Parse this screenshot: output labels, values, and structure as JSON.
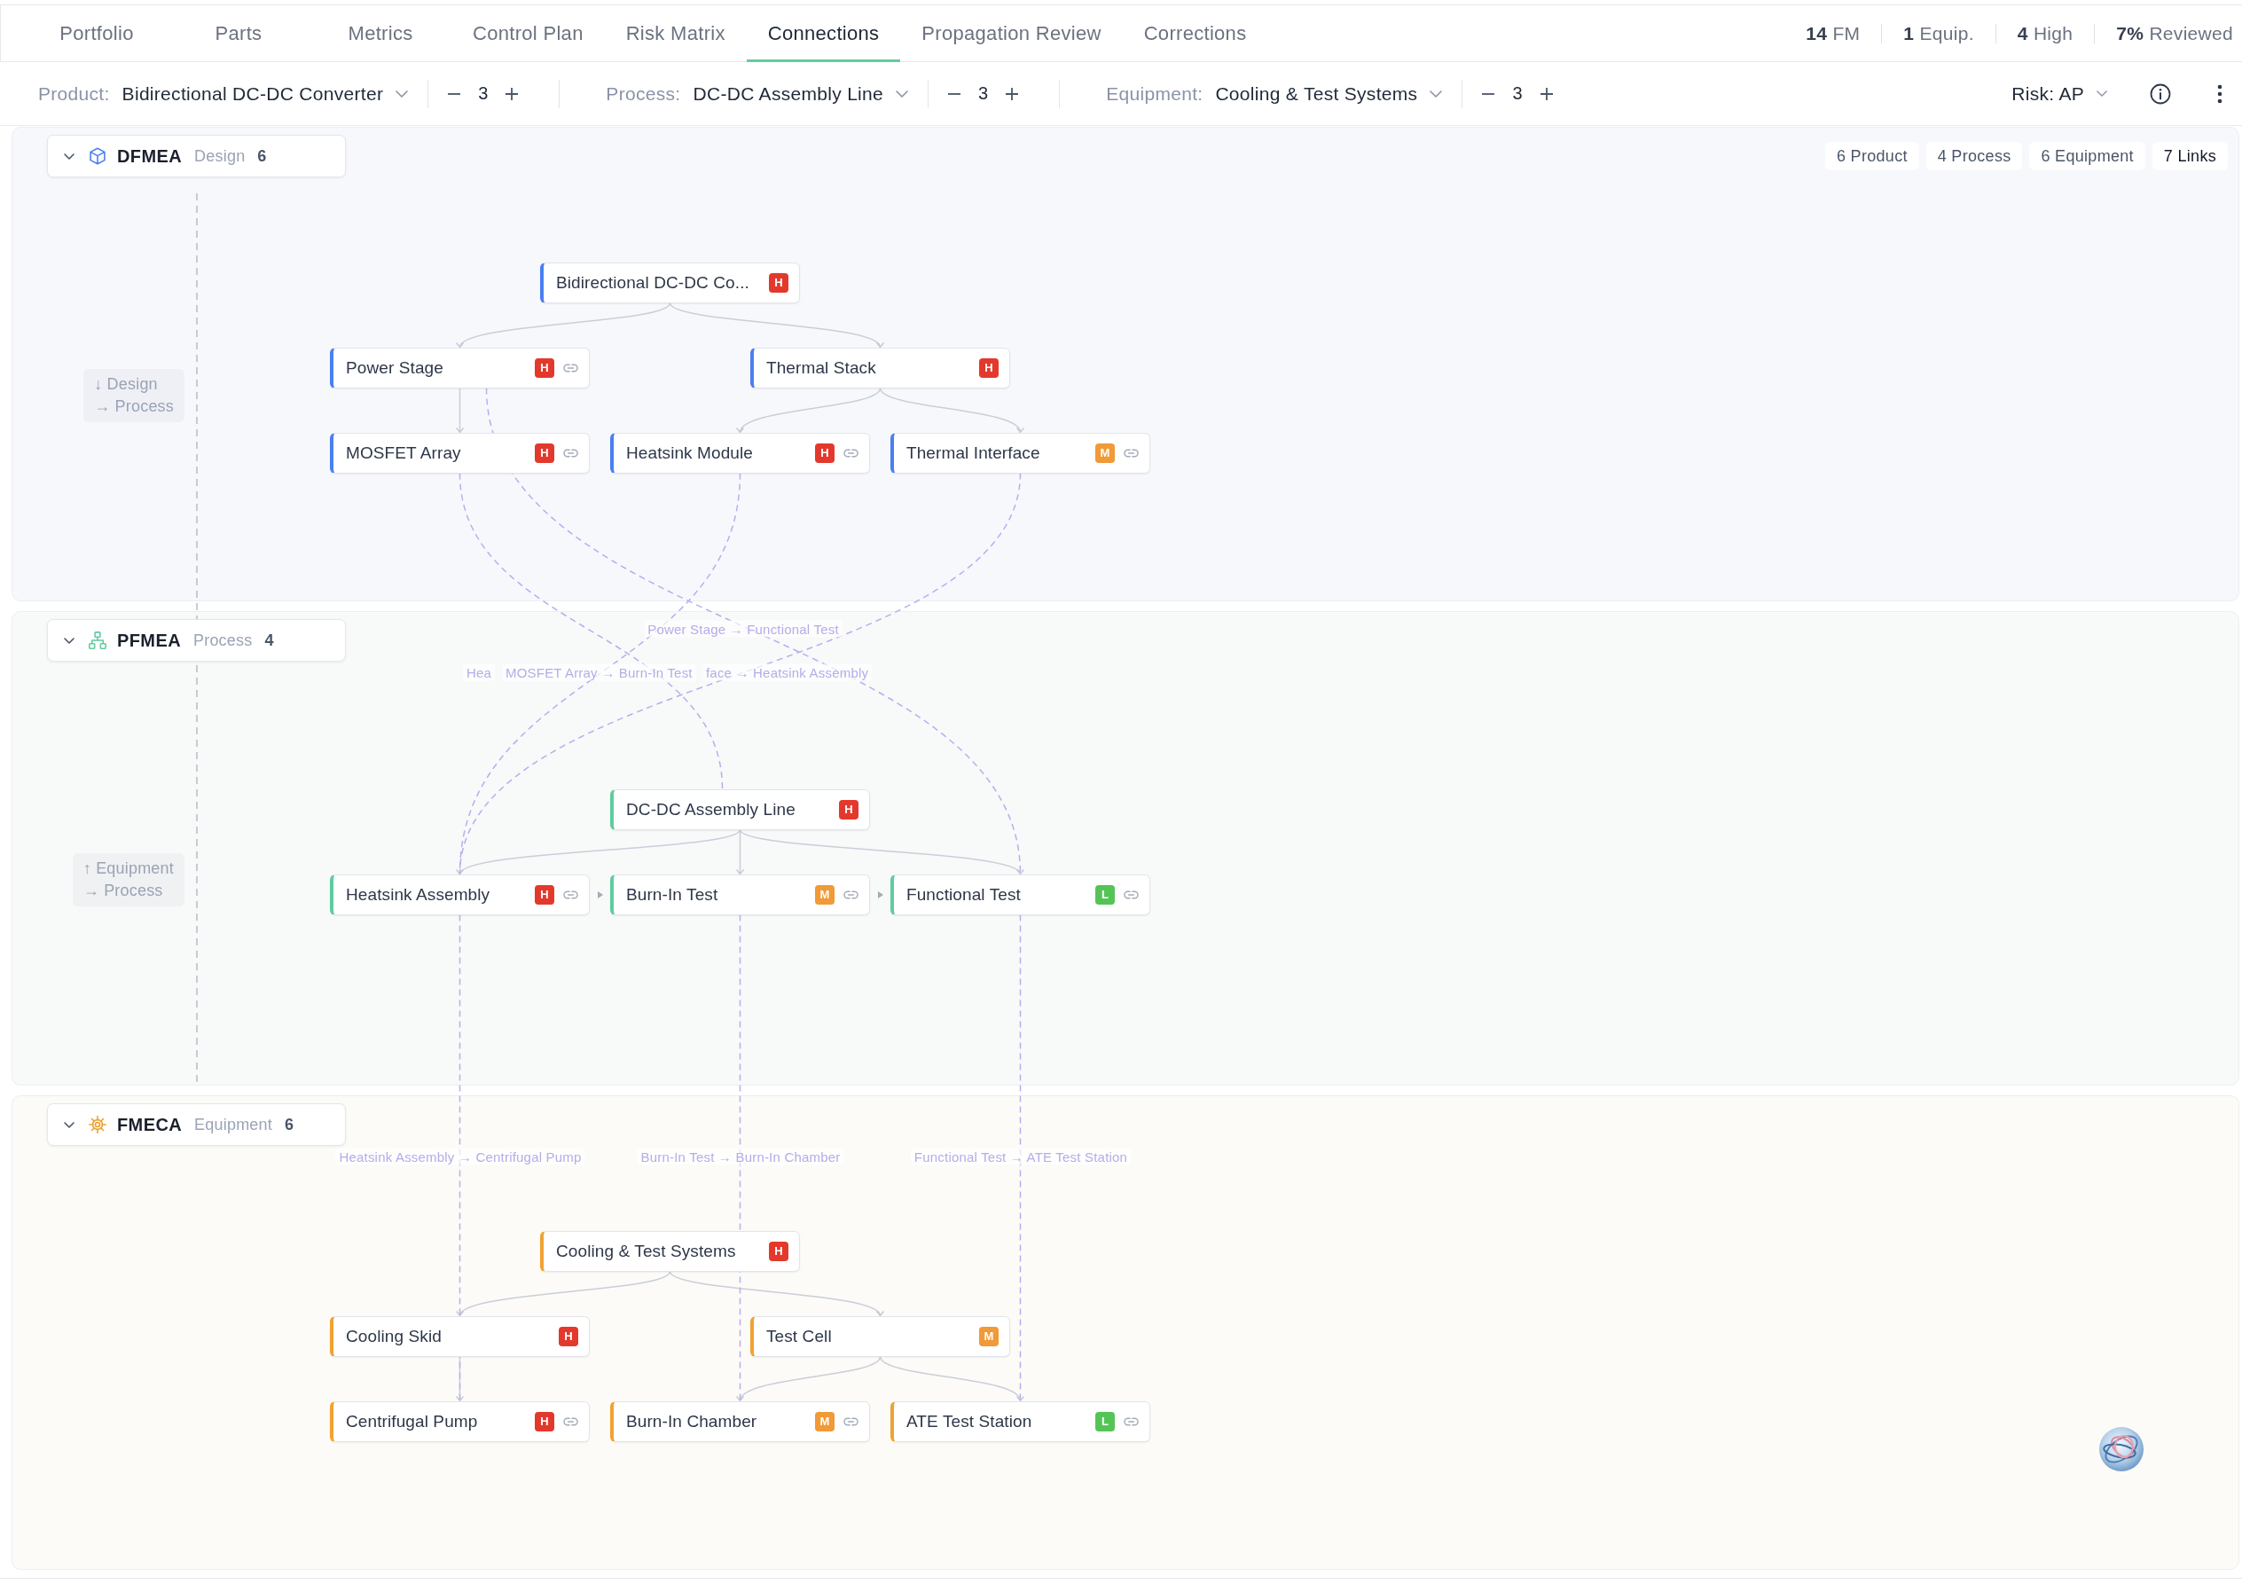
{
  "tabs": [
    {
      "label": "Portfolio",
      "selected": false
    },
    {
      "label": "Parts",
      "selected": false
    },
    {
      "label": "Metrics",
      "selected": false
    },
    {
      "label": "Control Plan",
      "selected": false
    },
    {
      "label": "Risk Matrix",
      "selected": false
    },
    {
      "label": "Connections",
      "selected": true
    },
    {
      "label": "Propagation Review",
      "selected": false
    },
    {
      "label": "Corrections",
      "selected": false
    }
  ],
  "stats": [
    {
      "value": "14",
      "label": "FM"
    },
    {
      "value": "1",
      "label": "Equip."
    },
    {
      "value": "4",
      "label": "High"
    },
    {
      "value": "7%",
      "label": "Reviewed"
    }
  ],
  "filters": [
    {
      "label": "Product:",
      "value": "Bidirectional DC-DC Converter",
      "depth": "3"
    },
    {
      "label": "Process:",
      "value": "DC-DC Assembly Line",
      "depth": "3"
    },
    {
      "label": "Equipment:",
      "value": "Cooling & Test Systems",
      "depth": "3"
    }
  ],
  "risk_select": {
    "value": "Risk: AP"
  },
  "lanes": [
    {
      "kind": "design",
      "title": "DFMEA",
      "subtitle": "Design",
      "count": "6",
      "color": "#4a7ff0",
      "expanded": true,
      "chips": [
        {
          "label": "6 Product",
          "selected": false
        },
        {
          "label": "4 Process",
          "selected": false
        },
        {
          "label": "6 Equipment",
          "selected": false
        },
        {
          "label": "7 Links",
          "selected": true
        }
      ],
      "direction_note": [
        "↓ Design",
        "→ Process"
      ],
      "tree": {
        "name": "Bidirectional DC-DC Co...",
        "risk": {
          "label": "H",
          "color": "#e3392c"
        },
        "linked": false,
        "children": [
          {
            "name": "Power Stage",
            "risk": {
              "label": "H",
              "color": "#e3392c"
            },
            "linked": true,
            "children": [
              {
                "name": "MOSFET Array",
                "risk": {
                  "label": "H",
                  "color": "#e3392c"
                },
                "linked": true
              }
            ]
          },
          {
            "name": "Thermal Stack",
            "risk": {
              "label": "H",
              "color": "#e3392c"
            },
            "linked": false,
            "children": [
              {
                "name": "Heatsink Module",
                "risk": {
                  "label": "H",
                  "color": "#e3392c"
                },
                "linked": true
              },
              {
                "name": "Thermal Interface",
                "risk": {
                  "label": "M",
                  "color": "#f09a38"
                },
                "linked": true
              }
            ]
          }
        ]
      }
    },
    {
      "kind": "process",
      "title": "PFMEA",
      "subtitle": "Process",
      "count": "4",
      "color": "#5fcc9d",
      "expanded": true,
      "direction_note": [
        "↑ Equipment",
        "→ Process"
      ],
      "tree": {
        "name": "DC-DC Assembly Line",
        "risk": {
          "label": "H",
          "color": "#e3392c"
        },
        "linked": false,
        "children": [
          {
            "name": "Heatsink Assembly",
            "risk": {
              "label": "H",
              "color": "#e3392c"
            },
            "linked": true
          },
          {
            "name": "Burn-In Test",
            "risk": {
              "label": "M",
              "color": "#f09a38"
            },
            "linked": true
          },
          {
            "name": "Functional Test",
            "risk": {
              "label": "L",
              "color": "#55c456"
            },
            "linked": true
          }
        ]
      }
    },
    {
      "kind": "equipment",
      "title": "FMECA",
      "subtitle": "Equipment",
      "count": "6",
      "color": "#f0a232",
      "expanded": true,
      "tree": {
        "name": "Cooling & Test Systems",
        "risk": {
          "label": "H",
          "color": "#e3392c"
        },
        "linked": false,
        "children": [
          {
            "name": "Cooling Skid",
            "risk": {
              "label": "H",
              "color": "#e3392c"
            },
            "linked": false,
            "children": [
              {
                "name": "Centrifugal Pump",
                "risk": {
                  "label": "H",
                  "color": "#e3392c"
                },
                "linked": true
              }
            ]
          },
          {
            "name": "Test Cell",
            "risk": {
              "label": "M",
              "color": "#f09a38"
            },
            "linked": false,
            "children": [
              {
                "name": "Burn-In Chamber",
                "risk": {
                  "label": "M",
                  "color": "#f09a38"
                },
                "linked": true
              },
              {
                "name": "ATE Test Station",
                "risk": {
                  "label": "L",
                  "color": "#55c456"
                },
                "linked": true
              }
            ]
          }
        ]
      }
    }
  ],
  "links": [
    {
      "label": "Power Stage → Functional Test"
    },
    {
      "label": "Hea"
    },
    {
      "label": "MOSFET Array → Burn-In Test"
    },
    {
      "label": "face → Heatsink Assembly"
    },
    {
      "label": "Heatsink Assembly → Centrifugal Pump"
    },
    {
      "label": "Burn-In Test → Burn-In Chamber"
    },
    {
      "label": "Functional Test → ATE Test Station"
    }
  ]
}
